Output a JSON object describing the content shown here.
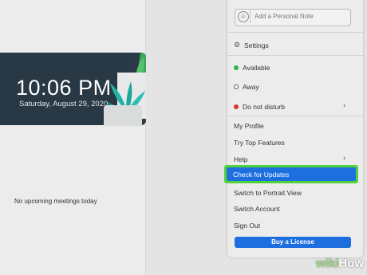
{
  "clock": {
    "time": "10:06 PM",
    "date": "Saturday, August 29, 2020"
  },
  "meetings": {
    "empty_text": "No upcoming meetings today"
  },
  "menu": {
    "note_placeholder": "Add a Personal Note",
    "settings": "Settings",
    "status": {
      "available": "Available",
      "away": "Away",
      "dnd": "Do not disturb"
    },
    "items": {
      "profile": "My Profile",
      "top_features": "Try Top Features",
      "help": "Help",
      "check_updates": "Check for Updates",
      "portrait": "Switch to Portrait View",
      "switch_account": "Switch Account",
      "sign_out": "Sign Out"
    },
    "license_button": "Buy a License"
  },
  "watermark": {
    "prefix": "wiki",
    "suffix": "How"
  },
  "colors": {
    "accent": "#1d6fe0",
    "highlight_border": "#52d23a",
    "available": "#2fb54a",
    "dnd": "#d9342c",
    "clock_bg": "#283845"
  }
}
